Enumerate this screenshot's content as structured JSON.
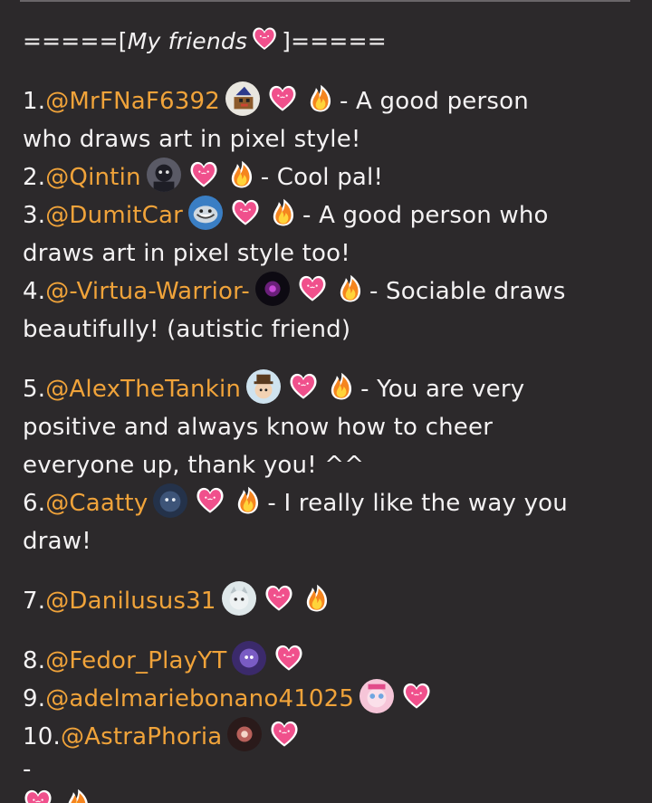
{
  "header": {
    "prefix": "=====[",
    "title": "My friends",
    "suffix": "]====="
  },
  "friends": [
    {
      "num": "1.",
      "handle": "@MrFNaF6392",
      "desc_line1": "- A good person",
      "desc_line2": "who draws art in pixel style!"
    },
    {
      "num": "2.",
      "handle": "@Qintin",
      "desc_line1": "- Cool pal!"
    },
    {
      "num": "3.",
      "handle": "@DumitCar",
      "desc_line1": "- A good person who",
      "desc_line2": "draws art in pixel style too!"
    },
    {
      "num": "4.",
      "handle": "@-Virtua-Warrior-",
      "desc_line1": "- Sociable draws",
      "desc_line2": "beautifully! (autistic friend)"
    },
    {
      "num": "5.",
      "handle": "@AlexTheTankin",
      "desc_line1": "- You are very",
      "desc_line2": "positive and always know how to cheer",
      "desc_line3": "everyone up, thank you! ^^"
    },
    {
      "num": "6.",
      "handle": "@Caatty",
      "desc_line1": "- I really like the way you",
      "desc_line2": "draw!"
    },
    {
      "num": "7.",
      "handle": "@Danilusus31"
    },
    {
      "num": "8.",
      "handle": "@Fedor_PlayYT"
    },
    {
      "num": "9.",
      "handle": "@adelmariebonano41025"
    },
    {
      "num": "10.",
      "handle": "@AstraPhoria"
    }
  ],
  "separator": "-",
  "icons": {
    "heart": "pink-heart-face-icon",
    "fire": "fire-icon"
  },
  "colors": {
    "background": "#2c292b",
    "text": "#f4f2f3",
    "mention": "#f0a33a",
    "heart": "#f0508c"
  }
}
